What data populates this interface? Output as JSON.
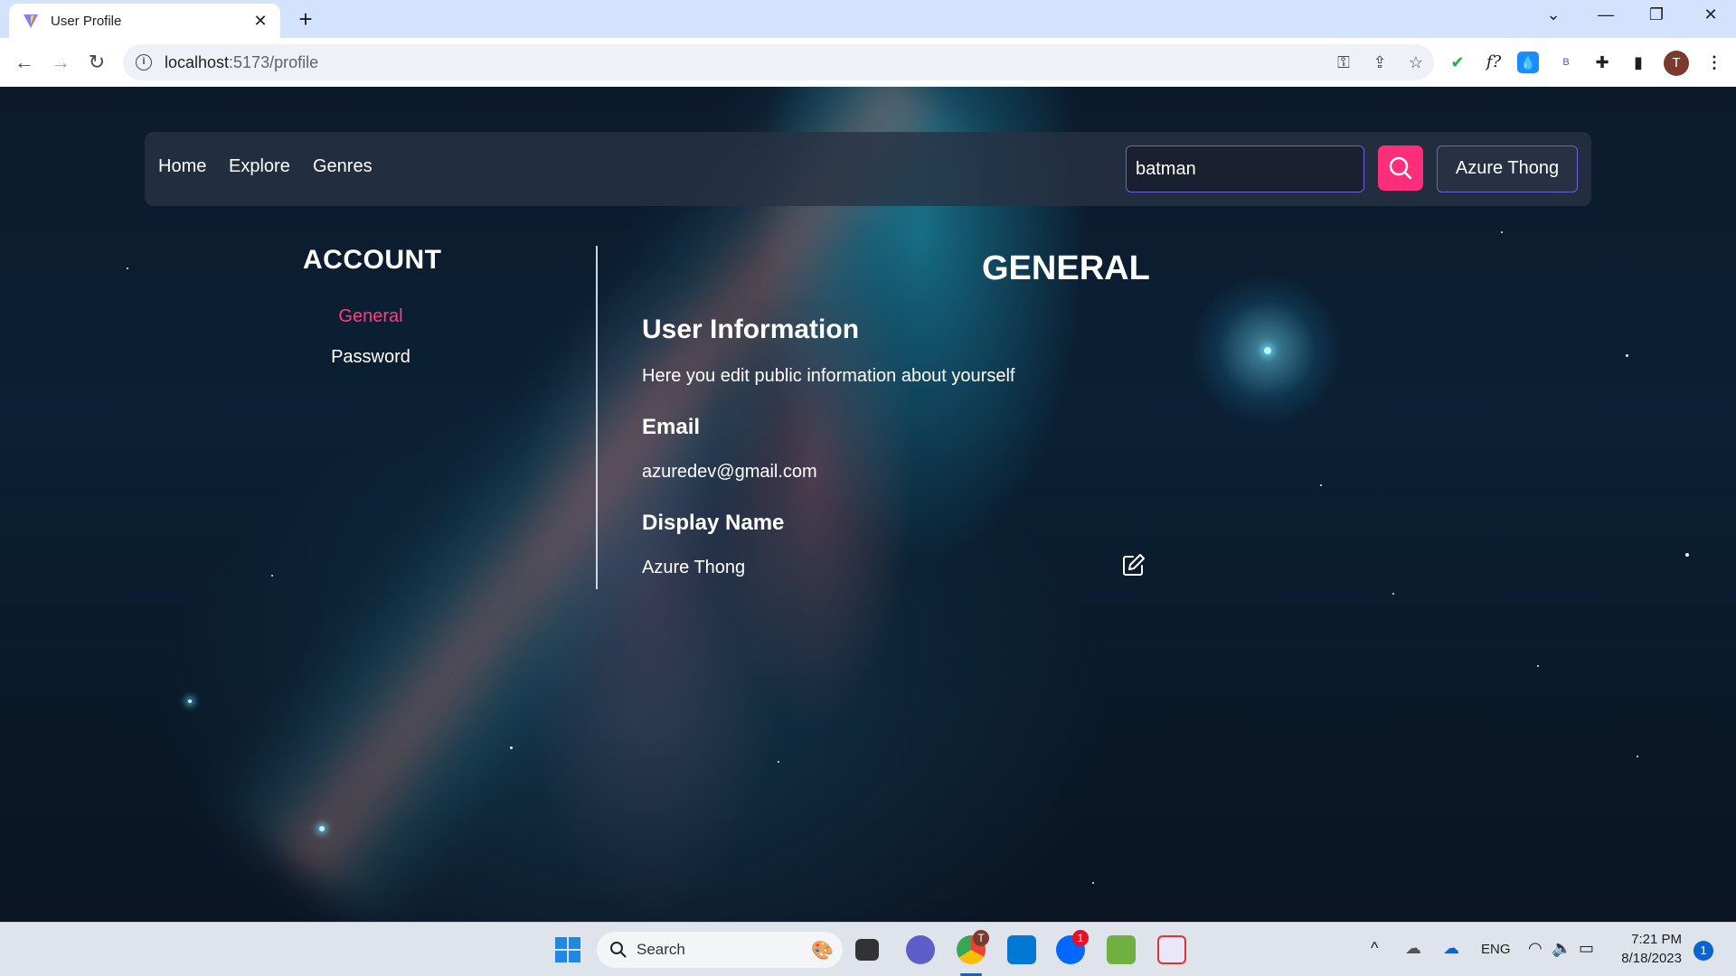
{
  "browser": {
    "tab_title": "User Profile",
    "url_host": "localhost",
    "url_rest": ":5173/profile"
  },
  "nav": {
    "home": "Home",
    "explore": "Explore",
    "genres": "Genres",
    "search_value": "batman",
    "user_button": "Azure Thong"
  },
  "sidebar": {
    "title": "ACCOUNT",
    "items": [
      {
        "label": "General",
        "active": true
      },
      {
        "label": "Password",
        "active": false
      }
    ]
  },
  "main": {
    "title": "GENERAL",
    "user_info_heading": "User Information",
    "user_info_desc": "Here you edit public information about yourself",
    "email_heading": "Email",
    "email_value": "azuredev@gmail.com",
    "display_name_heading": "Display Name",
    "display_name_value": "Azure Thong"
  },
  "taskbar": {
    "search_label": "Search",
    "language": "ENG",
    "time": "7:21 PM",
    "date": "8/18/2023",
    "notification_count": "1",
    "zalo_badge": "1",
    "chrome_avatar": "T"
  },
  "toolbar_avatar": "T",
  "colors": {
    "accent_pink": "#ff2d7a",
    "active_link": "#ff3d7f",
    "border_purple": "#6b63d9"
  }
}
